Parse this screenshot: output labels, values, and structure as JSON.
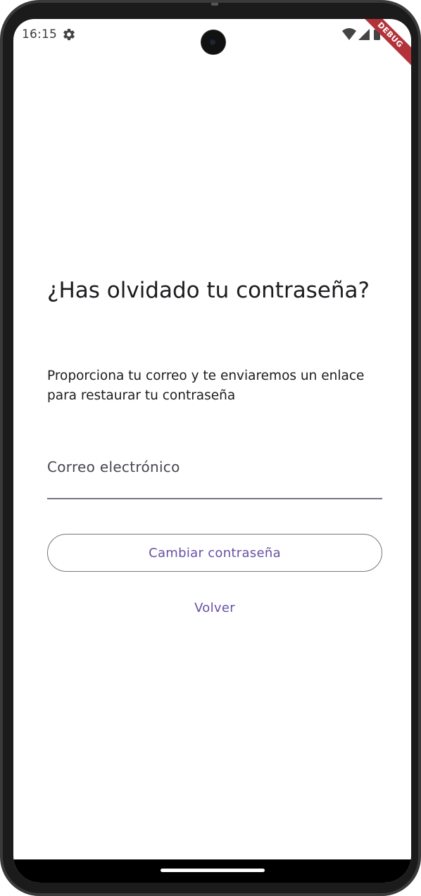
{
  "status_bar": {
    "time": "16:15",
    "icons": [
      "settings-gear-icon",
      "wifi-icon",
      "cellular-signal-icon",
      "battery-icon"
    ],
    "debug_banner": "DEBUG"
  },
  "screen": {
    "title": "¿Has olvidado tu contraseña?",
    "subtitle": "Proporciona tu correo y te enviaremos un enlace para restaurar tu contraseña",
    "email_field": {
      "label": "Correo electrónico",
      "value": ""
    },
    "submit_button": "Cambiar contraseña",
    "back_button": "Volver"
  },
  "colors": {
    "primary": "#6750a4",
    "text": "#1c1b1f",
    "outline": "#79747e",
    "debug_ribbon": "#b3333b"
  }
}
